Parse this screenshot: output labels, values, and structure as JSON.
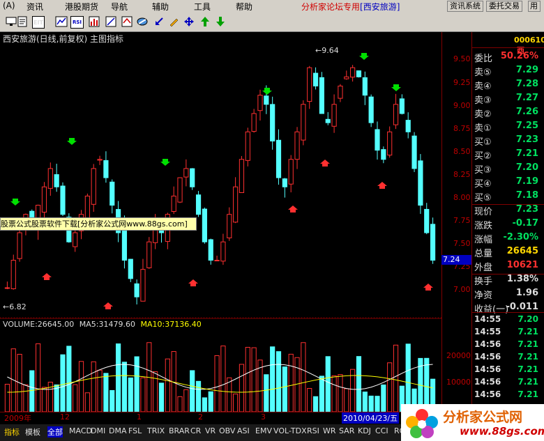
{
  "menu": {
    "items": [
      "(A)",
      "资讯",
      "港股期货",
      "导航",
      "辅助",
      "工具",
      "帮助"
    ],
    "title": "分析家论坛专用",
    "stock_tag": "[西安旅游]",
    "btn_info": "资讯系统",
    "btn_trade": "委托交易"
  },
  "toolbar": {
    "icons": [
      "monitor-icon",
      "f10-icon",
      "eit-icon",
      "kline-icon",
      "rsi-icon",
      "bar-icon",
      "scale-icon",
      "mirror-icon",
      "export-icon",
      "pencil-icon",
      "move-icon",
      "up-arrow-icon",
      "down-arrow-icon"
    ],
    "labels": [
      "",
      "",
      "EIT",
      "",
      "RSI",
      "",
      "",
      "",
      "",
      "",
      "",
      "",
      ""
    ]
  },
  "chart": {
    "title": "西安旅游(日线,前复权) 主图指标",
    "high_label": "9.64",
    "low_label": "6.82",
    "current_price": "7.24",
    "y_ticks": [
      "9.50",
      "9.25",
      "9.00",
      "8.75",
      "8.50",
      "8.25",
      "8.00",
      "7.75",
      "7.50",
      "7.25",
      "7.00"
    ],
    "ad_text": "股票公式股票软件下载[分析家公式网www.88gs.com]",
    "colors": {
      "up": "#ff3030",
      "down": "#54ffff",
      "arrow_up": "#ff3030",
      "arrow_down": "#00e000"
    }
  },
  "volume": {
    "label_vol": "VOLUME:26645.00",
    "label_ma5": "MA5:31479.60",
    "label_ma10": "MA10:37136.40",
    "y_ticks": [
      "20000",
      "10000"
    ]
  },
  "dates": {
    "labels": [
      "2009年",
      "12",
      "1",
      "2",
      "3"
    ],
    "selected": "2010/04/23/五"
  },
  "quote": {
    "code": "000610",
    "code_suffix": "西",
    "rows": [
      {
        "k": "委比",
        "v": "50.26%",
        "c": "#ff3030"
      },
      {
        "k": "卖⑤",
        "v": "7.29",
        "c": "#00e060"
      },
      {
        "k": "卖④",
        "v": "7.28",
        "c": "#00e060"
      },
      {
        "k": "卖③",
        "v": "7.27",
        "c": "#00e060"
      },
      {
        "k": "卖②",
        "v": "7.26",
        "c": "#00e060"
      },
      {
        "k": "卖①",
        "v": "7.25",
        "c": "#00e060"
      },
      {
        "k": "买①",
        "v": "7.23",
        "c": "#00e060"
      },
      {
        "k": "买②",
        "v": "7.21",
        "c": "#00e060"
      },
      {
        "k": "买③",
        "v": "7.20",
        "c": "#00e060"
      },
      {
        "k": "买④",
        "v": "7.19",
        "c": "#00e060"
      },
      {
        "k": "买⑤",
        "v": "7.18",
        "c": "#00e060"
      },
      {
        "k": "现价",
        "v": "7.23",
        "c": "#00e060"
      },
      {
        "k": "涨跌",
        "v": "-0.17",
        "c": "#00e060"
      },
      {
        "k": "涨幅",
        "v": "-2.30%",
        "c": "#00e060"
      },
      {
        "k": "总量",
        "v": "26645",
        "c": "#ffd700"
      },
      {
        "k": "外盘",
        "v": "10621",
        "c": "#ff3030"
      },
      {
        "k": "换手",
        "v": "1.38%",
        "c": "#ddd"
      },
      {
        "k": "净资",
        "v": "1.96",
        "c": "#ddd"
      },
      {
        "k": "收益(一)",
        "v": "-0.011",
        "c": "#ddd"
      }
    ],
    "ticks": [
      {
        "t": "14:55",
        "p": "7.20"
      },
      {
        "t": "14:55",
        "p": "7.21"
      },
      {
        "t": "14:56",
        "p": "7.21"
      },
      {
        "t": "14:56",
        "p": "7.21"
      },
      {
        "t": "14:56",
        "p": "7.21"
      },
      {
        "t": "14:56",
        "p": "7.21"
      },
      {
        "t": "14:56",
        "p": "7.21"
      }
    ]
  },
  "tabs": [
    "指标",
    "模板",
    "全部",
    "MACD",
    "DMI",
    "DMA",
    "FSL",
    "TRIX",
    "BRAR",
    "CR",
    "VR",
    "OBV",
    "ASI",
    "EMV",
    "VOL-TDX",
    "RSI",
    "WR",
    "SAR",
    "KDJ",
    "CCI",
    "RO"
  ],
  "logo": {
    "name": "分析家公式网",
    "url": "www.88gs.com"
  }
}
